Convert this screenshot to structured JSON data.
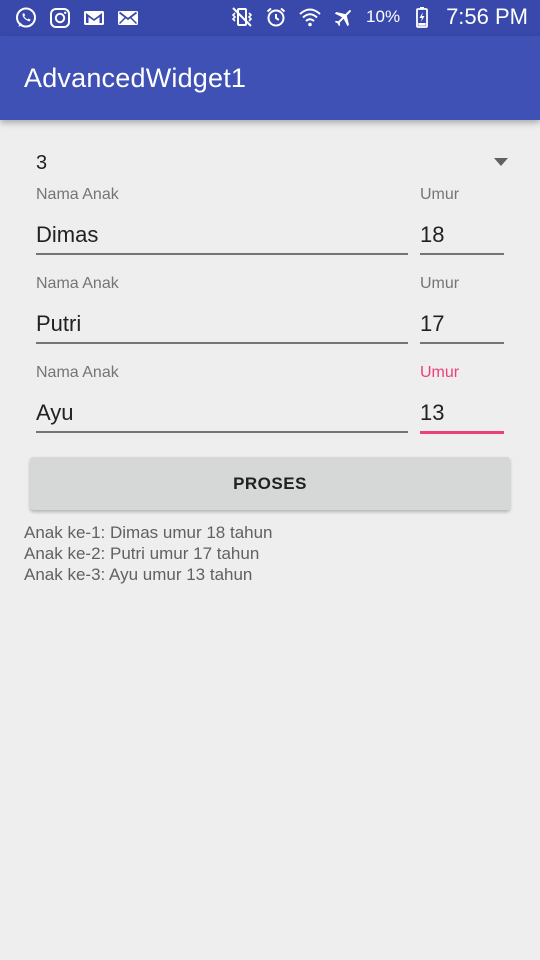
{
  "status_bar": {
    "left_icons": [
      "whatsapp-icon",
      "instagram-icon",
      "gmail-icon",
      "email-icon"
    ],
    "right_icons": [
      "vibrate-icon",
      "alarm-icon",
      "wifi-icon",
      "airplane-mode-icon"
    ],
    "battery_percent": "10%",
    "time": "7:56 PM",
    "color": "#3949ab"
  },
  "app_bar": {
    "title": "AdvancedWidget1",
    "color": "#3f51b5"
  },
  "spinner": {
    "selected_value": "3"
  },
  "children": [
    {
      "name_label": "Nama Anak",
      "name_value": "Dimas",
      "age_label": "Umur",
      "age_value": "18",
      "age_focused": false
    },
    {
      "name_label": "Nama Anak",
      "name_value": "Putri",
      "age_label": "Umur",
      "age_value": "17",
      "age_focused": false
    },
    {
      "name_label": "Nama Anak",
      "name_value": "Ayu",
      "age_label": "Umur",
      "age_value": "13",
      "age_focused": true
    }
  ],
  "accent_color": "#ec407a",
  "button": {
    "label": "PROSES"
  },
  "results": [
    "Anak ke-1: Dimas umur 18 tahun",
    "Anak ke-2: Putri umur 17 tahun",
    "Anak ke-3: Ayu umur 13 tahun"
  ]
}
